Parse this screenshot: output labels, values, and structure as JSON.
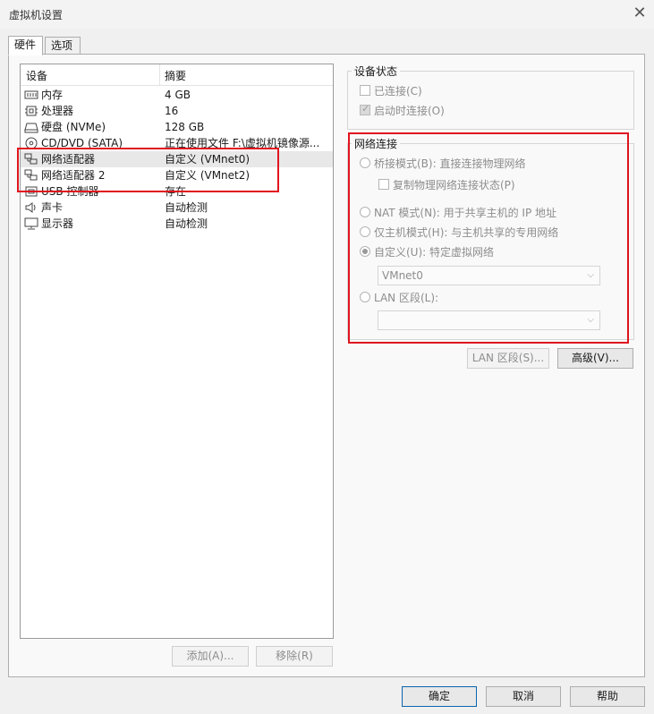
{
  "window": {
    "title": "虚拟机设置"
  },
  "tabs": [
    {
      "label": "硬件"
    },
    {
      "label": "选项"
    }
  ],
  "device_list": {
    "columns": {
      "device": "设备",
      "summary": "摘要"
    },
    "rows": [
      {
        "icon": "memory-icon",
        "name": "内存",
        "summary": "4 GB"
      },
      {
        "icon": "processor-icon",
        "name": "处理器",
        "summary": "16"
      },
      {
        "icon": "hard-disk-icon",
        "name": "硬盘 (NVMe)",
        "summary": "128 GB"
      },
      {
        "icon": "cd-dvd-icon",
        "name": "CD/DVD (SATA)",
        "summary": "正在使用文件 F:\\虚拟机镜像源..."
      },
      {
        "icon": "network-adapter-icon",
        "name": "网络适配器",
        "summary": "自定义 (VMnet0)"
      },
      {
        "icon": "network-adapter-icon",
        "name": "网络适配器 2",
        "summary": "自定义 (VMnet2)"
      },
      {
        "icon": "usb-icon",
        "name": "USB 控制器",
        "summary": "存在"
      },
      {
        "icon": "sound-card-icon",
        "name": "声卡",
        "summary": "自动检测"
      },
      {
        "icon": "display-icon",
        "name": "显示器",
        "summary": "自动检测"
      }
    ]
  },
  "buttons": {
    "add": "添加(A)...",
    "remove": "移除(R)",
    "lan_segments": "LAN 区段(S)...",
    "advanced": "高级(V)...",
    "ok": "确定",
    "cancel": "取消",
    "help": "帮助"
  },
  "device_status": {
    "title": "设备状态",
    "connected": {
      "label": "已连接(C)",
      "checked": false
    },
    "connect_at_power_on": {
      "label": "启动时连接(O)",
      "checked": true
    }
  },
  "network_connection": {
    "title": "网络连接",
    "bridged": {
      "label": "桥接模式(B): 直接连接物理网络",
      "selected": false
    },
    "replicate": {
      "label": "复制物理网络连接状态(P)",
      "checked": false
    },
    "nat": {
      "label": "NAT 模式(N): 用于共享主机的 IP 地址",
      "selected": false
    },
    "host_only": {
      "label": "仅主机模式(H): 与主机共享的专用网络",
      "selected": false
    },
    "custom": {
      "label": "自定义(U): 特定虚拟网络",
      "selected": true
    },
    "custom_value": "VMnet0",
    "lan_segment": {
      "label": "LAN 区段(L):",
      "selected": false
    },
    "lan_value": ""
  }
}
